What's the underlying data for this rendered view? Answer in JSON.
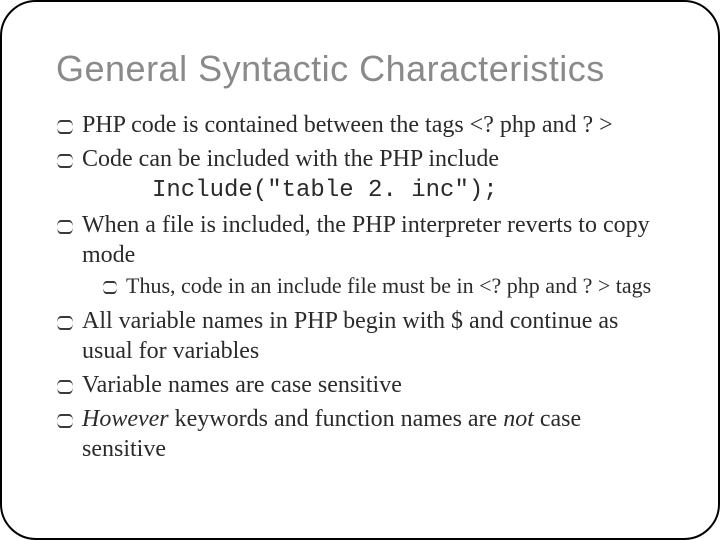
{
  "title": "General Syntactic Characteristics",
  "bullets": {
    "b1": "PHP code is contained between the tags <? php  and ? >",
    "b2_line1": "Code can be included with the PHP include",
    "b2_code": "Include(\"table 2. inc\");",
    "b3": "When a file is included, the PHP interpreter reverts to copy mode",
    "b3_sub": "Thus, code in an include file must be in <? php  and ? > tags",
    "b4": "All variable names in PHP begin with $ and continue as usual for variables",
    "b5": "Variable names are case sensitive",
    "b6_prefix": "However",
    "b6_mid": " keywords and function names are ",
    "b6_not": "not",
    "b6_suffix": " case sensitive"
  }
}
